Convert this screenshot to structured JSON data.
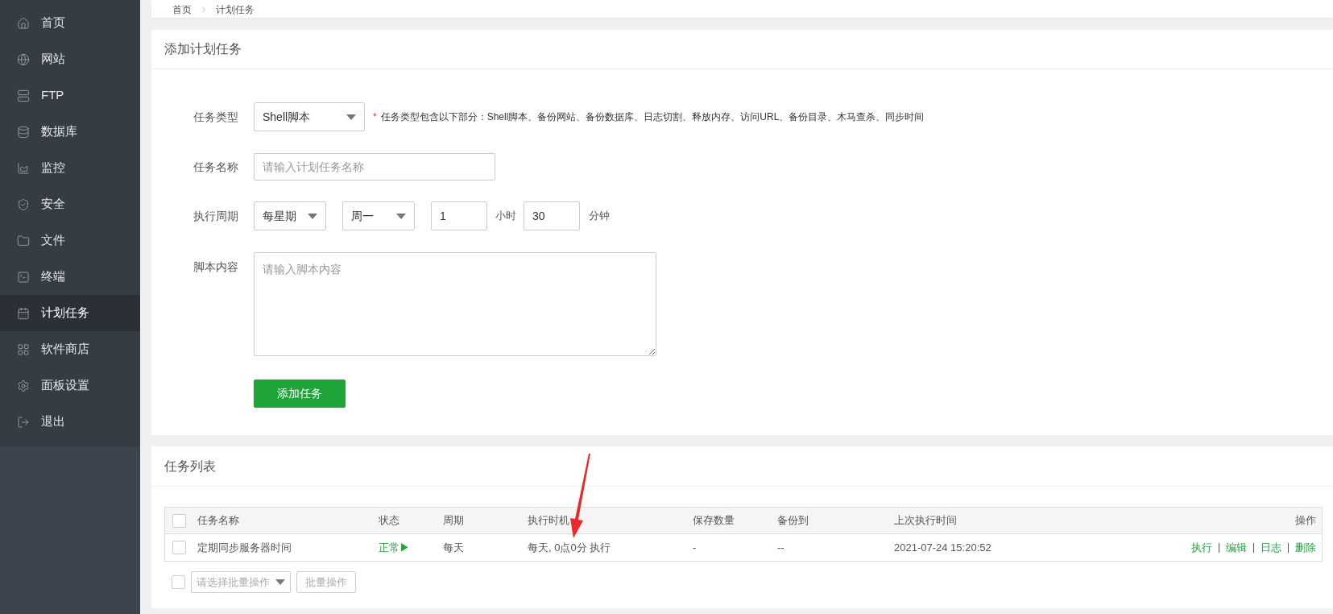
{
  "sidebar": {
    "items": [
      {
        "label": "首页",
        "selected": false
      },
      {
        "label": "网站",
        "selected": false
      },
      {
        "label": "FTP",
        "selected": false
      },
      {
        "label": "数据库",
        "selected": false
      },
      {
        "label": "监控",
        "selected": false
      },
      {
        "label": "安全",
        "selected": false
      },
      {
        "label": "文件",
        "selected": false
      },
      {
        "label": "终端",
        "selected": false
      },
      {
        "label": "计划任务",
        "selected": true
      },
      {
        "label": "软件商店",
        "selected": false
      },
      {
        "label": "面板设置",
        "selected": false
      },
      {
        "label": "退出",
        "selected": false
      }
    ]
  },
  "breadcrumb": [
    "首页",
    "计划任务"
  ],
  "add_task": {
    "title": "添加计划任务",
    "task_type": {
      "label": "任务类型",
      "value": "Shell脚本",
      "required_mark": "*",
      "hint": "任务类型包含以下部分：Shell脚本、备份网站、备份数据库、日志切割、释放内存、访问URL、备份目录、木马查杀、同步时间"
    },
    "task_name": {
      "label": "任务名称",
      "placeholder": "请输入计划任务名称"
    },
    "cycle": {
      "label": "执行周期",
      "period": "每星期",
      "weekday": "周一",
      "hour": "1",
      "hour_unit": "小时",
      "minute": "30",
      "minute_unit": "分钟"
    },
    "script": {
      "label": "脚本内容",
      "placeholder": "请输入脚本内容"
    },
    "submit": "添加任务"
  },
  "task_list": {
    "title": "任务列表",
    "header_checked": false,
    "columns": [
      "任务名称",
      "状态",
      "周期",
      "执行时机",
      "保存数量",
      "备份到",
      "上次执行时间",
      "操作"
    ],
    "rows": [
      {
        "checked": false,
        "name": "定期同步服务器时间",
        "status": "正常▶",
        "status_ok": true,
        "cycle": "每天",
        "timing": "每天, 0点0分 执行",
        "save_count": "-",
        "backup_to": "--",
        "last_run": "2021-07-24 15:20:52",
        "actions": [
          "执行",
          "编辑",
          "日志",
          "删除"
        ]
      }
    ],
    "batch": {
      "checked": false,
      "placeholder": "请选择批量操作",
      "button": "批量操作"
    }
  }
}
